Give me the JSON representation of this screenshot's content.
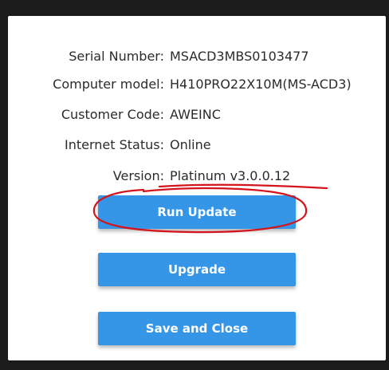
{
  "info": {
    "serial_label": "Serial Number:",
    "serial_value": "MSACD3MBS0103477",
    "model_label": "Computer model:",
    "model_value": "H410PRO22X10M(MS-ACD3)",
    "customer_label": "Customer Code:",
    "customer_value": "AWEINC",
    "internet_label": "Internet Status:",
    "internet_value": "Online",
    "version_label": "Version:",
    "version_value": "Platinum v3.0.0.12"
  },
  "buttons": {
    "run_update": "Run Update",
    "upgrade": "Upgrade",
    "save_close": "Save and Close"
  },
  "colors": {
    "button_blue": "#3596e8",
    "annotation_red": "#d4141c",
    "frame": "#1b1b1b"
  }
}
